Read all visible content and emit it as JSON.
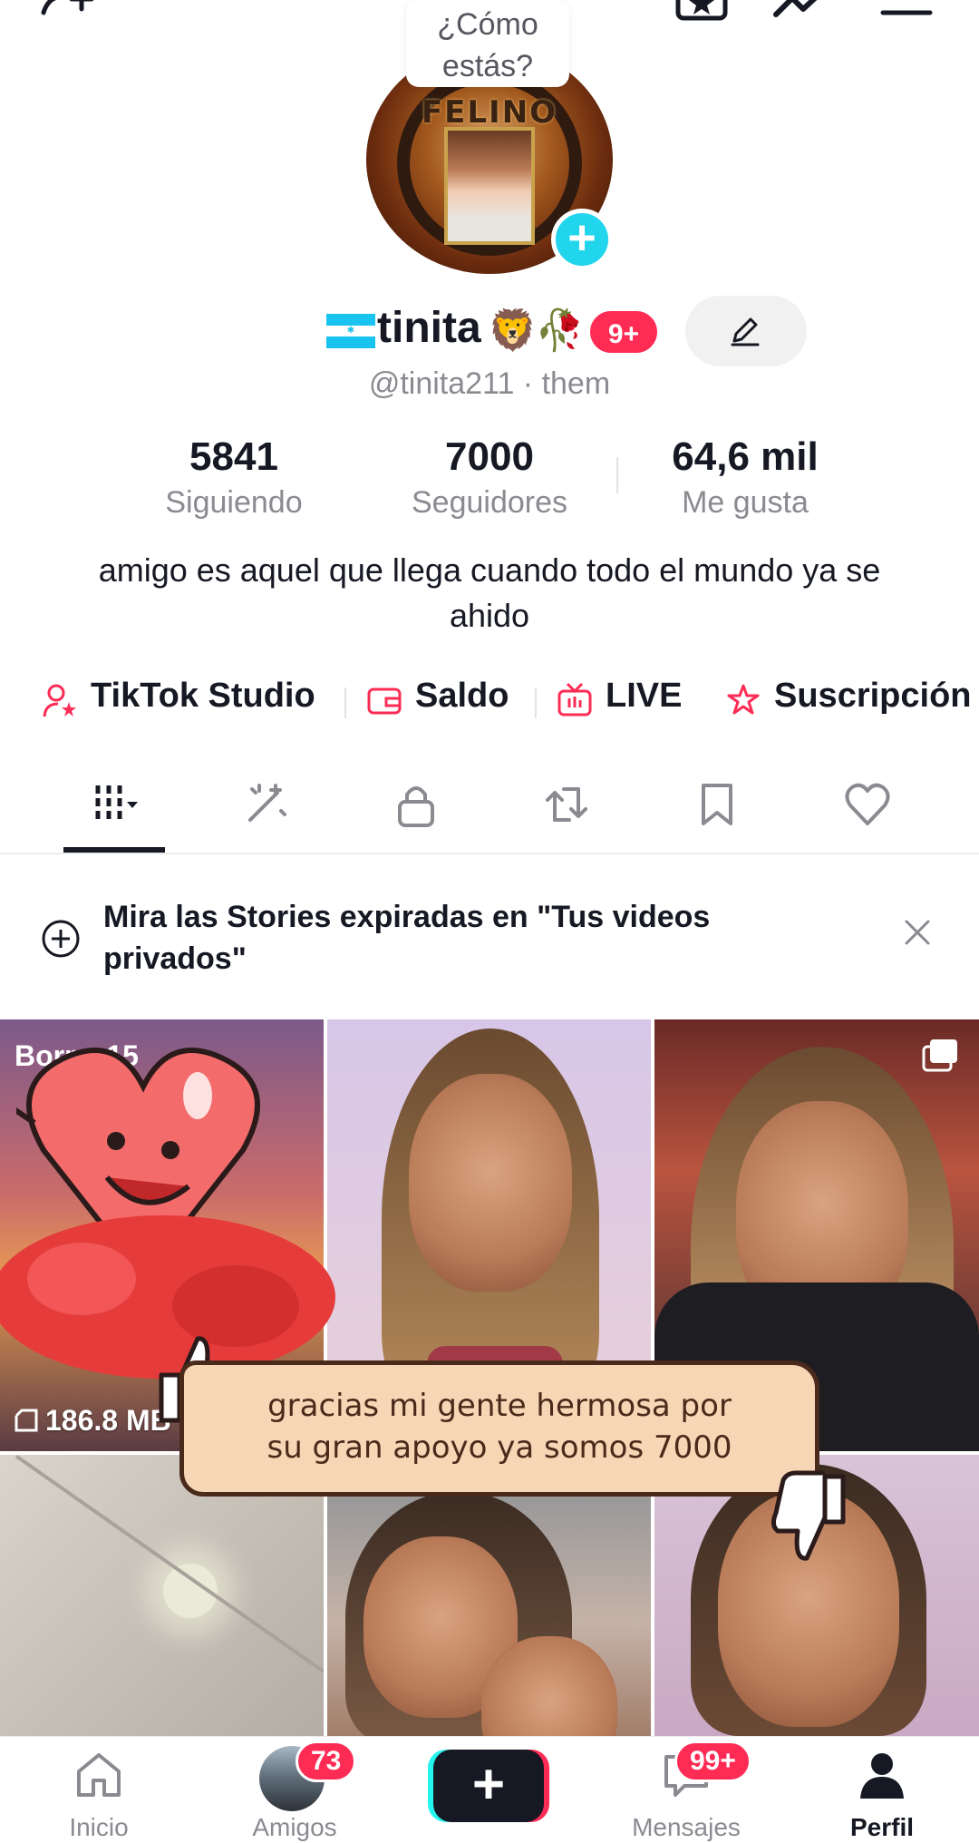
{
  "header": {
    "greeting_bubble": "¿Cómo estás?"
  },
  "profile": {
    "avatar_text": "FELINO",
    "name": "tinita",
    "name_emojis": [
      "🦁",
      "🥀"
    ],
    "notification_badge": "9+",
    "handle": "@tinita211 · them",
    "bio": "amigo es aquel que llega cuando todo el mundo ya se ahido"
  },
  "stats": [
    {
      "value": "5841",
      "label": "Siguiendo"
    },
    {
      "value": "7000",
      "label": "Seguidores"
    },
    {
      "value": "64,6 mil",
      "label": "Me gusta"
    }
  ],
  "quick_links": [
    {
      "label": "TikTok Studio",
      "icon": "user-star-icon"
    },
    {
      "label": "Saldo",
      "icon": "wallet-icon"
    },
    {
      "label": "LIVE",
      "icon": "live-tv-icon"
    },
    {
      "label": "Suscripción",
      "icon": "subscription-star-icon"
    }
  ],
  "tabs": [
    {
      "name": "videos-grid-icon",
      "active": true
    },
    {
      "name": "sparkle-icon"
    },
    {
      "name": "lock-icon"
    },
    {
      "name": "repost-icon"
    },
    {
      "name": "bookmark-icon"
    },
    {
      "name": "heart-icon"
    }
  ],
  "banner": {
    "text": "Mira las Stories expiradas en \"Tus videos privados\""
  },
  "videos": [
    {
      "overlay_text": "Borr... 15",
      "views": "186.8 MB"
    },
    {},
    {
      "multi_image": true
    },
    {},
    {},
    {}
  ],
  "sticker": {
    "caption_line1": "gracias mi gente hermosa por",
    "caption_line2": "su gran apoyo ya somos 7000"
  },
  "bottom_nav": {
    "home": "Inicio",
    "friends": "Amigos",
    "friends_badge": "73",
    "messages": "Mensajes",
    "messages_badge": "99+",
    "profile": "Perfil"
  },
  "colors": {
    "accent": "#fe2c55",
    "cyan": "#20d5ec"
  }
}
